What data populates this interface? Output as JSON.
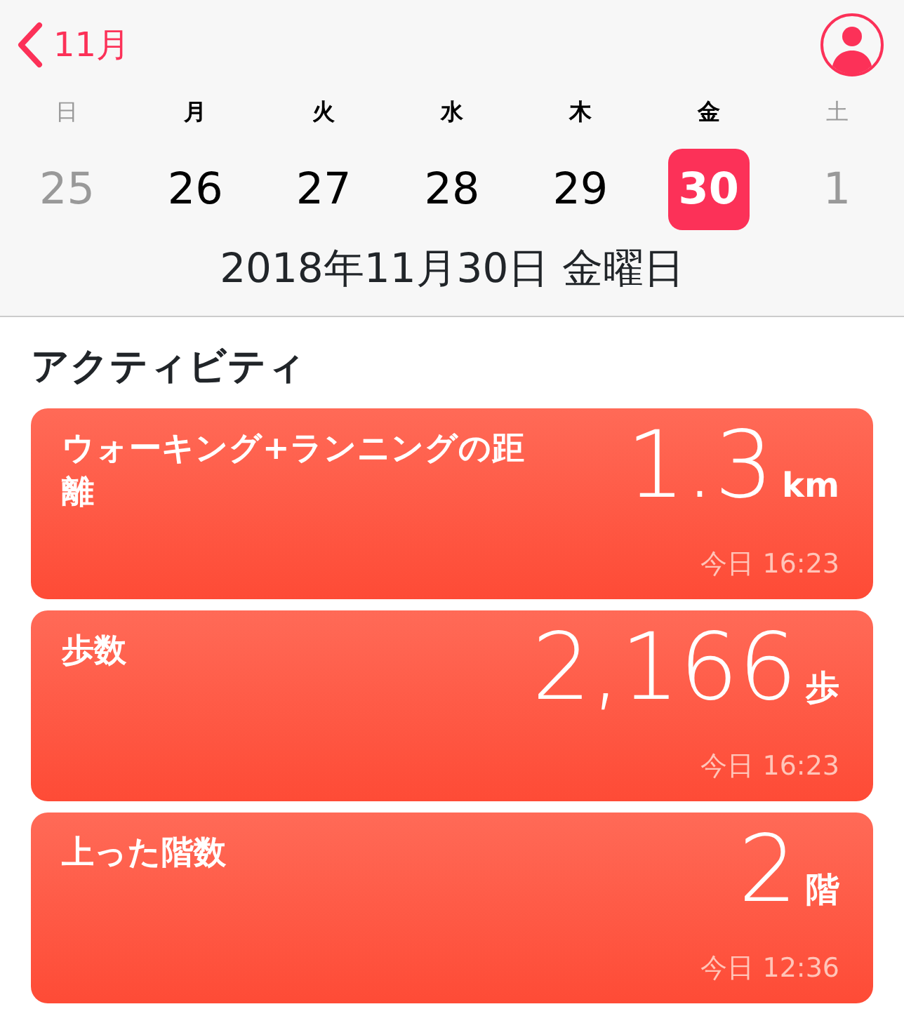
{
  "nav": {
    "back_label": "11月"
  },
  "week": [
    {
      "weekday": "日",
      "date": "25",
      "weekend": true,
      "selected": false
    },
    {
      "weekday": "月",
      "date": "26",
      "weekend": false,
      "selected": false
    },
    {
      "weekday": "火",
      "date": "27",
      "weekend": false,
      "selected": false
    },
    {
      "weekday": "水",
      "date": "28",
      "weekend": false,
      "selected": false
    },
    {
      "weekday": "木",
      "date": "29",
      "weekend": false,
      "selected": false
    },
    {
      "weekday": "金",
      "date": "30",
      "weekend": false,
      "selected": true
    },
    {
      "weekday": "土",
      "date": "1",
      "weekend": true,
      "selected": false
    }
  ],
  "selected_date": "2018年11月30日 金曜日",
  "section_title": "アクティビティ",
  "cards": [
    {
      "title": "ウォーキング+ランニングの距離",
      "value": "1.3",
      "unit": "km",
      "time": "今日 16:23"
    },
    {
      "title": "歩数",
      "value": "2,166",
      "unit": "歩",
      "time": "今日 16:23"
    },
    {
      "title": "上った階数",
      "value": "2",
      "unit": "階",
      "time": "今日 12:36"
    }
  ]
}
